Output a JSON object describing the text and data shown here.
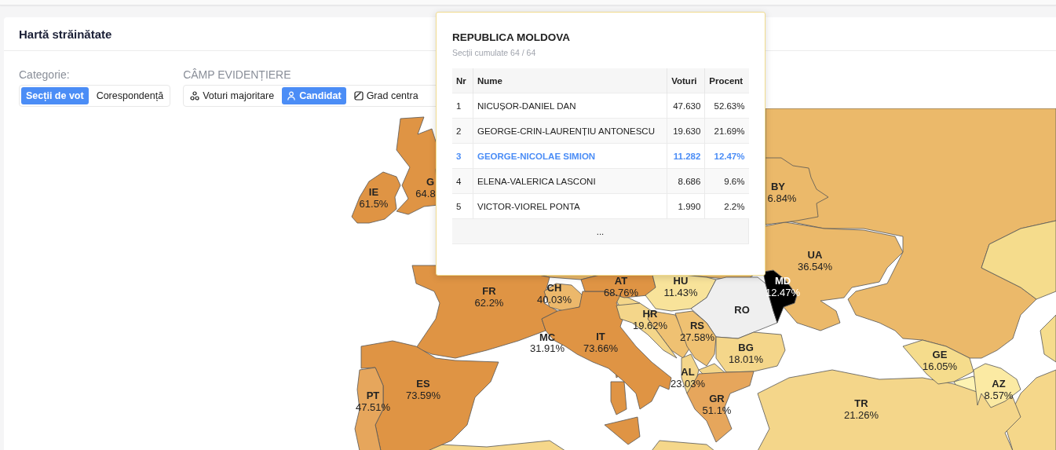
{
  "header": {
    "title": "Hartă străinătate"
  },
  "category": {
    "label": "Categorie:",
    "options": [
      {
        "label": "Secții de vot",
        "selected": true
      },
      {
        "label": "Corespondență",
        "selected": false
      }
    ]
  },
  "highlight_field": {
    "label": "CÂMP EVIDENȚIERE",
    "options": [
      {
        "kind": "majority",
        "label": "Voturi majoritare",
        "selected": false
      },
      {
        "kind": "candidate",
        "label": "Candidat",
        "selected": true
      },
      {
        "kind": "degree",
        "label": "Grad centra",
        "selected": false
      }
    ]
  },
  "map": {
    "countries": [
      {
        "code": "IE",
        "percent": "61.5%",
        "color": "#df9444"
      },
      {
        "code": "G",
        "percent": "64.8",
        "color": "#df9444"
      },
      {
        "code": "FR",
        "percent": "62.2%",
        "color": "#df9444"
      },
      {
        "code": "ES",
        "percent": "73.59%",
        "color": "#df9444"
      },
      {
        "code": "PT",
        "percent": "47.51%",
        "color": "#e6a65c"
      },
      {
        "code": "CH",
        "percent": "40.03%",
        "color": "#ecb86b"
      },
      {
        "code": "IT",
        "percent": "73.66%",
        "color": "#df9444"
      },
      {
        "code": "AT",
        "percent": "68.76%",
        "color": "#df9444"
      },
      {
        "code": "HU",
        "percent": "11.43%",
        "color": "#f8e39a"
      },
      {
        "code": "RO",
        "color": "#efefef"
      },
      {
        "code": "MD",
        "percent": "12.47%",
        "color": "#000000"
      },
      {
        "code": "UA",
        "percent": "36.54%",
        "color": "#ebb96a"
      },
      {
        "code": "BY",
        "percent": "6.84%",
        "color": "#ebb96a"
      },
      {
        "code": "HR",
        "percent": "19.62%",
        "color": "#f4d68a"
      },
      {
        "code": "RS",
        "percent": "27.58%",
        "color": "#efc172"
      },
      {
        "code": "AL",
        "percent": "23.03%",
        "color": "#f4d68a"
      },
      {
        "code": "BG",
        "percent": "18.01%",
        "color": "#f4d68a"
      },
      {
        "code": "GR",
        "percent": "51.1%",
        "color": "#e6a65c"
      },
      {
        "code": "TR",
        "percent": "21.26%",
        "color": "#f4d68a"
      },
      {
        "code": "GE",
        "percent": "16.05%",
        "color": "#f5dc8c"
      },
      {
        "code": "AZ",
        "percent": "8.57%",
        "color": "#fbeaa3"
      }
    ],
    "mc_label": {
      "code": "MC",
      "percent": "31.91%"
    }
  },
  "tooltip": {
    "title": "REPUBLICA MOLDOVA",
    "subtitle": "Secții cumulate 64 / 64",
    "columns": [
      "Nr",
      "Nume",
      "Voturi",
      "Procent"
    ],
    "rows": [
      {
        "nr": "1",
        "name": "NICUȘOR-DANIEL DAN",
        "votes": "47.630",
        "percent": "52.63%",
        "selected": false
      },
      {
        "nr": "2",
        "name": "GEORGE-CRIN-LAURENȚIU ANTONESCU",
        "votes": "19.630",
        "percent": "21.69%",
        "selected": false
      },
      {
        "nr": "3",
        "name": "GEORGE-NICOLAE SIMION",
        "votes": "11.282",
        "percent": "12.47%",
        "selected": true
      },
      {
        "nr": "4",
        "name": "ELENA-VALERICA LASCONI",
        "votes": "8.686",
        "percent": "9.6%",
        "selected": false
      },
      {
        "nr": "5",
        "name": "VICTOR-VIOREL PONTA",
        "votes": "1.990",
        "percent": "2.2%",
        "selected": false
      }
    ],
    "more": "..."
  }
}
